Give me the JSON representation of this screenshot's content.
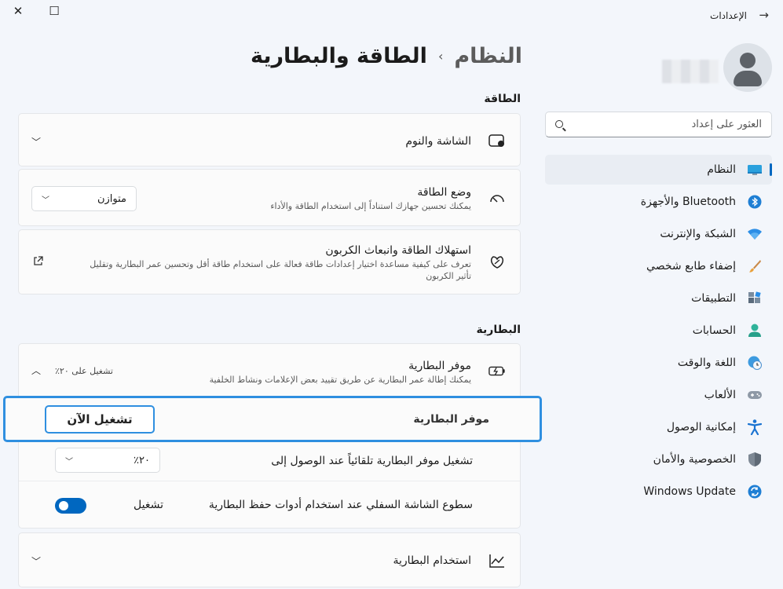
{
  "window": {
    "title": "الإعدادات",
    "close_glyph": "✕",
    "maximize_glyph": "☐",
    "back_glyph": "→"
  },
  "search": {
    "placeholder": "العثور على إعداد"
  },
  "breadcrumb": {
    "parent": "النظام",
    "separator": "›",
    "current": "الطاقة والبطارية"
  },
  "sidebar": {
    "items": [
      {
        "label": "النظام",
        "icon": "monitor-icon",
        "active": true
      },
      {
        "label": "Bluetooth والأجهزة",
        "icon": "bluetooth-icon"
      },
      {
        "label": "الشبكة والإنترنت",
        "icon": "wifi-icon"
      },
      {
        "label": "إضفاء طابع شخصي",
        "icon": "brush-icon"
      },
      {
        "label": "التطبيقات",
        "icon": "apps-icon"
      },
      {
        "label": "الحسابات",
        "icon": "person-icon"
      },
      {
        "label": "اللغة والوقت",
        "icon": "globe-clock-icon"
      },
      {
        "label": "الألعاب",
        "icon": "gamepad-icon"
      },
      {
        "label": "إمكانية الوصول",
        "icon": "accessibility-icon"
      },
      {
        "label": "الخصوصية والأمان",
        "icon": "shield-icon"
      },
      {
        "label": "Windows Update",
        "icon": "update-icon"
      }
    ]
  },
  "power_section": {
    "title": "الطاقة",
    "screen_sleep": {
      "title": "الشاشة والنوم"
    },
    "power_mode": {
      "title": "وضع الطاقة",
      "subtitle": "يمكنك تحسين جهازك استناداً إلى استخدام الطاقة والأداء",
      "value": "متوازن"
    },
    "energy": {
      "title": "استهلاك الطاقة وانبعاث الكربون",
      "subtitle_line1": "تعرف على كيفية مساعدة اختيار إعدادات طاقة فعالة على استخدام طاقة أقل وتحسين عمر البطارية وتقليل",
      "subtitle_line2": "تأثير الكربون"
    }
  },
  "battery_section": {
    "title": "البطارية",
    "saver": {
      "title": "موفر البطارية",
      "subtitle": "يمكنك إطالة عمر البطارية عن طريق تقييد بعض الإعلامات ونشاط الخلفية",
      "status": "تشغيل على ٢٠٪"
    },
    "saver_row": {
      "label": "موفر البطارية",
      "button": "تشغيل الآن"
    },
    "auto_on": {
      "label": "تشغيل موفر البطارية تلقائياً عند الوصول إلى",
      "value": "٢٠٪"
    },
    "brightness": {
      "label": "سطوع الشاشة السفلي عند استخدام أدوات حفظ البطارية",
      "state": "تشغيل",
      "on": true
    },
    "usage": {
      "title": "استخدام البطارية"
    }
  }
}
